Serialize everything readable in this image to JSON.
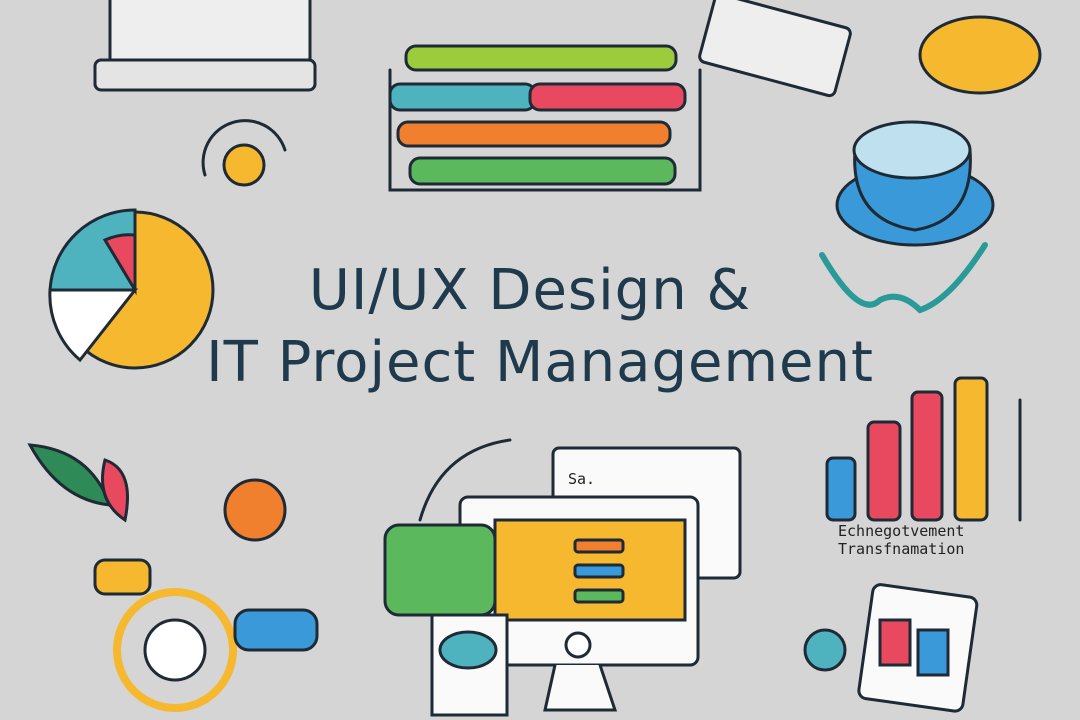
{
  "title": {
    "line1": "UI/UX Design  &",
    "line2": "IT Project Management"
  },
  "chart_caption": {
    "line1": "Echnegotvement",
    "line2": "Transfnamation"
  },
  "window_label": "Sa.",
  "colors": {
    "background": "#d5d5d5",
    "title": "#1e3a4c",
    "green": "#5cb85c",
    "teal": "#4fb3bf",
    "red": "#e8495f",
    "orange": "#f07f2e",
    "yellow": "#f5b82e",
    "blue": "#3a9ad9"
  }
}
